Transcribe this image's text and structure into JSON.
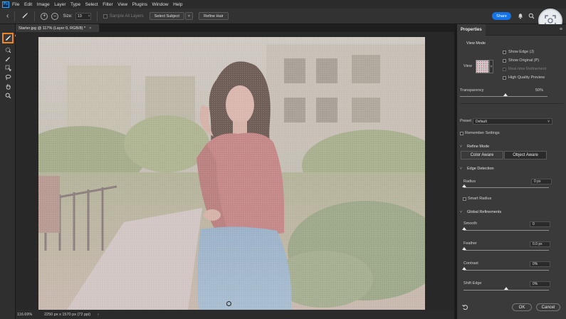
{
  "menu": {
    "logo": "Ps",
    "items": [
      "File",
      "Edit",
      "Image",
      "Layer",
      "Type",
      "Select",
      "Filter",
      "View",
      "Plugins",
      "Window",
      "Help"
    ]
  },
  "options": {
    "size_label": "Size:",
    "size_value": "13",
    "sample_all_layers": "Sample All Layers",
    "select_subject": "Select Subject",
    "refine_hair": "Refine Hair",
    "share": "Share"
  },
  "document": {
    "tab_title": "Starter.jpg @ 117% (Layer 0, RGB/8) *",
    "zoom": "116.69%",
    "size": "2250 px x 1570 px (72 ppi)"
  },
  "properties": {
    "tab": "Properties",
    "view_mode": {
      "title": "View Mode",
      "view_label": "View",
      "show_edge": "Show Edge (J)",
      "show_original": "Show Original (P)",
      "realtime_refinement": "Real-time Refinement",
      "high_quality_preview": "High Quality Preview"
    },
    "transparency": {
      "label": "Transparency",
      "value": "50%",
      "level": 0.5
    },
    "preset": {
      "label": "Preset",
      "value": "Default"
    },
    "remember_settings": "Remember Settings",
    "refine_mode": {
      "title": "Refine Mode",
      "color_aware": "Color Aware",
      "object_aware": "Object Aware"
    },
    "edge_detection": {
      "title": "Edge Detection",
      "radius_label": "Radius",
      "radius_value": "0 px",
      "smart_radius": "Smart Radius"
    },
    "global_refinements": {
      "title": "Global Refinements",
      "smooth_label": "Smooth",
      "smooth_value": "0",
      "feather_label": "Feather",
      "feather_value": "0.0 px",
      "contrast_label": "Contrast",
      "contrast_value": "0%",
      "shift_edge_label": "Shift Edge",
      "shift_edge_value": "0%"
    },
    "ok": "OK",
    "cancel": "Cancel"
  }
}
